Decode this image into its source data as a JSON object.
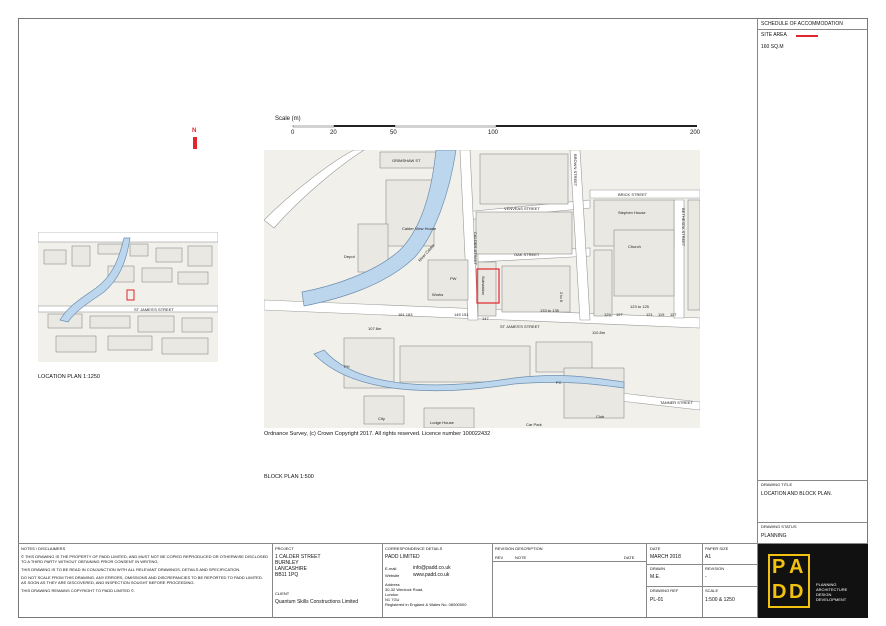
{
  "schedule": {
    "title": "SCHEDULE OF ACCOMMODATION",
    "site_area_label": "SITE AREA",
    "site_area_value": "160 SQ.M",
    "site_area_color": "#e0262b"
  },
  "scale_bar": {
    "title": "Scale (m)",
    "ticks": [
      "0",
      "20",
      "50",
      "100",
      "200"
    ]
  },
  "north_label": "N",
  "location_plan": {
    "caption": "LOCATION PLAN   1:1250",
    "map_street": "ST JAMES'S STREET"
  },
  "block_plan": {
    "caption": "BLOCK PLAN   1:500",
    "copyright": "Ordnance Survey, (c) Crown Copyright 2017. All rights reserved. Licence number 100022432",
    "labels": {
      "grimshaw": "GRIMSHAW ST",
      "calder_view": "Calder View House",
      "depot": "Depot",
      "river": "River Calder",
      "calder_st": "CALDER STREET",
      "brown_st": "BROWN STREET",
      "vesting": "VENVEAS STREET",
      "brick": "BRICK STREET",
      "oak": "OAK STREET",
      "stephen": "Stephen House",
      "church": "Church",
      "bethesda": "BETHESDA STREET",
      "pw": "PW",
      "works": "Works",
      "site": "Substation",
      "addr_133": "133 to 135",
      "addr_2": "2 to 6",
      "addr_123": "123 to 125",
      "addr_129": "129",
      "addr_127": "127",
      "addr_121": "121",
      "addr_119": "119",
      "addr_117": "117",
      "addr_145": "145 151",
      "addr_161": "161 163",
      "addr_147": "147",
      "bm1": "107.8m",
      "bm2": "110.8m",
      "st_james": "ST JAMES'S STREET",
      "ph": "PH",
      "club": "Club",
      "city": "City",
      "lodge": "Lodge House",
      "car_park": "Car Park",
      "tanner": "TANNER STREET",
      "fc": "FC"
    }
  },
  "drawing_title": {
    "label": "DRAWING TITLE",
    "value": "LOCATION AND BLOCK PLAN."
  },
  "drawing_status": {
    "label": "DRAWING STATUS",
    "value": "PLANNING"
  },
  "notes": {
    "heading": "NOTES / DISCLAIMERS",
    "items": [
      "© THIS DRAWING IS THE PROPERTY OF PADD LIMITED, AND MUST NOT BE COPIED REPRODUCED OR OTHERWISE DISCLOSED TO A THIRD PARTY WITHOUT OBTAINING PRIOR CONSENT IN WRITING.",
      "THIS DRAWING IS TO BE READ IN CONJUNCTION WITH ALL RELEVANT DRAWINGS, DETAILS AND SPECIFICATION.",
      "DO NOT SCALE FROM THIS DRAWING. ANY ERRORS, OMISSIONS AND DISCREPANCIES TO BE REPORTED TO PADD LIMITED. AS SOON AS THEY ARE DISCOVERED, AND INSPECTION SOUGHT BEFORE PROCEEDING.",
      "THIS DRAWING REMAINS COPYRIGHT TO PADD LIMITED ©."
    ]
  },
  "project": {
    "label": "PROJECT",
    "lines": [
      "1 CALDER STREET",
      "BURNLEY",
      "LANCASHIRE",
      "BB11 1PQ"
    ],
    "client_label": "CLIENT",
    "client": "Quantum Skills Constructions Limited"
  },
  "correspondence": {
    "label": "CORRESPONDENCE DETAILS",
    "company": "PADD LIMITED",
    "email_label": "E-mail",
    "email": "info@padd.co.uk",
    "website_label": "Website",
    "website": "www.padd.co.uk",
    "address_label": "Address",
    "address": [
      "30-32 Wenlock Road,",
      "London",
      "N1 7GU"
    ],
    "registered": "Registered in England & Wales No. 06000000"
  },
  "revision": {
    "label": "REVISION DESCRIPTION",
    "rev_col": "REV",
    "note_col": "NOTE",
    "date_col": "DATE"
  },
  "info": {
    "date_label": "DATE",
    "date": "MARCH 2018",
    "paper_label": "PAPER SIZE",
    "paper": "A1",
    "drawn_label": "DRAWN",
    "drawn": "M.E.",
    "revision_label": "REVISION",
    "revision": "-",
    "dwg_label": "DRAWING REF",
    "dwg": "PL-01",
    "scale_label": "SCALE",
    "scale": "1:500 & 1250"
  },
  "logo": {
    "letters": [
      "P",
      "A",
      "D",
      "D"
    ],
    "tagline": [
      "PLANNING",
      "ARCHITECTURE",
      "DESIGN",
      "DEVELOPMENT"
    ],
    "accent": "#f3c10f"
  }
}
